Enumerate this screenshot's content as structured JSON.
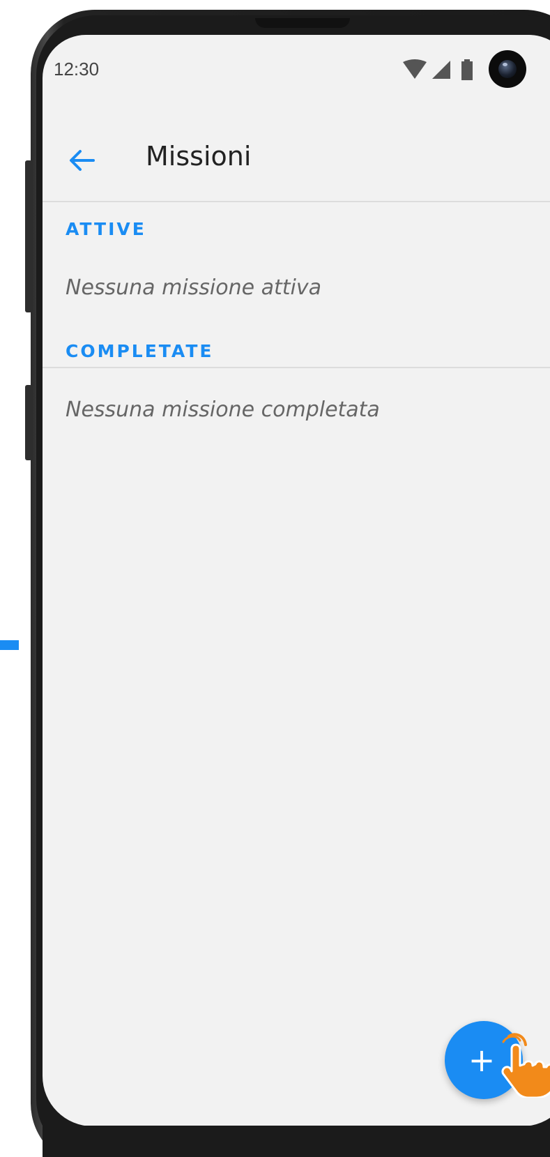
{
  "status_bar": {
    "time": "12:30",
    "icons": [
      "wifi-icon",
      "cell-signal-icon",
      "battery-icon"
    ]
  },
  "app_bar": {
    "back_icon": "arrow-left-icon",
    "title": "Missioni"
  },
  "sections": {
    "active": {
      "header": "ATTIVE",
      "empty_message": "Nessuna missione attiva"
    },
    "completed": {
      "header": "COMPLETATE",
      "empty_message": "Nessuna missione completata"
    }
  },
  "fab": {
    "label": "+",
    "icon": "plus-icon"
  },
  "overlay": {
    "cursor_icon": "hand-pointer-icon"
  },
  "colors": {
    "accent": "#1a8cf3",
    "screen_background": "#f2f2f2",
    "cursor": "#f28a1a"
  }
}
